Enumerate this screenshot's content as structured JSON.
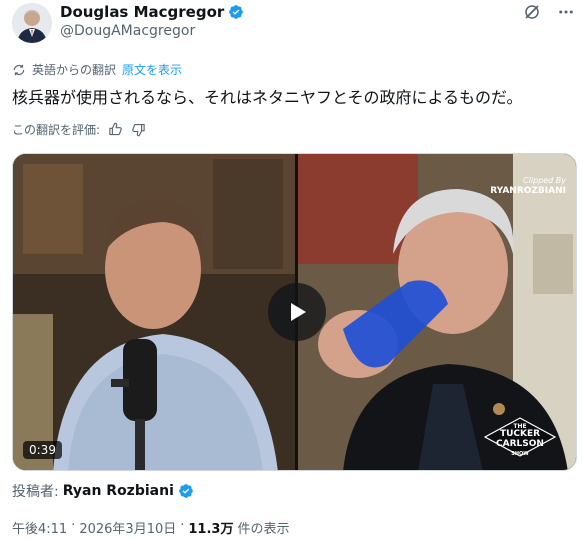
{
  "author": {
    "name": "Douglas Macgregor",
    "handle": "@DougAMacgregor",
    "verified_icon": "verified-badge-icon"
  },
  "header_icons": [
    "grok-icon",
    "more-icon"
  ],
  "translation": {
    "label": "英語からの翻訳",
    "show_original": "原文を表示",
    "icon": "translate-icon"
  },
  "tweet_text": "核兵器が使用されるなら、それはネタニヤフとその政府によるものだ。",
  "rate": {
    "label": "この翻訳を評価:",
    "icons": [
      "thumbs-up-icon",
      "thumbs-down-icon"
    ]
  },
  "media": {
    "duration": "0:39",
    "watermark_top": "Clipped By",
    "watermark_name": "RYANROZBIANI",
    "show_logo_line1": "THE",
    "show_logo_line2": "TUCKER",
    "show_logo_line3": "CARLSON",
    "show_logo_line4": "SHOW"
  },
  "posted": {
    "label": "投稿者:",
    "name": "Ryan Rozbiani"
  },
  "meta": {
    "time": "午後4:11",
    "sep": "·",
    "date": "2026年3月10日",
    "sep2": "·",
    "views": "11.3万",
    "views_label": "件の表示"
  },
  "colors": {
    "link": "#1d9bf0",
    "secondary_text": "#536471",
    "primary_text": "#0f1419"
  }
}
